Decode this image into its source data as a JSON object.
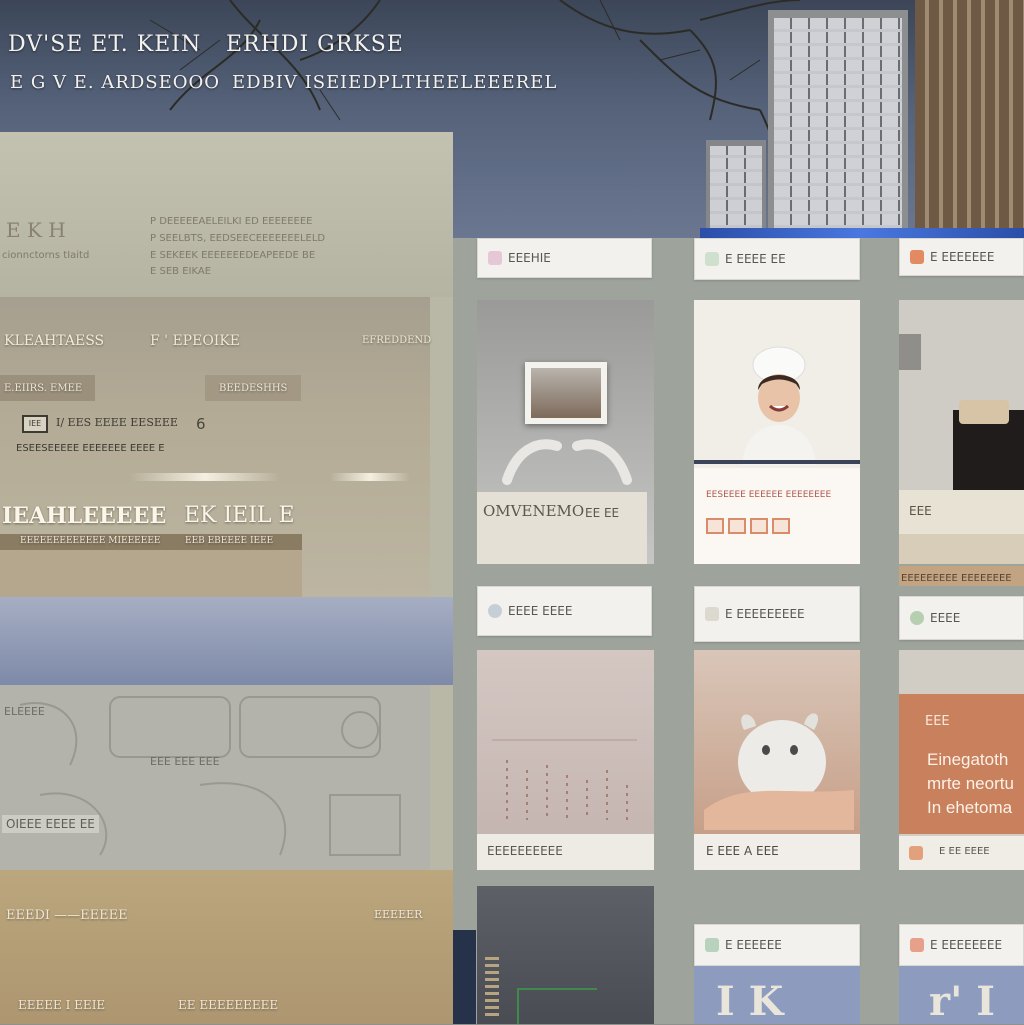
{
  "header": {
    "line1_left": "DV'SE ET.  KEIN",
    "line1_right": "ERHDI GRKSE",
    "line2_a": "E  G   V   E. ARDSEOOO",
    "line2_b": "EDBIV  ISE",
    "line2_c": "IEDPLTHEELEEEREL"
  },
  "left_panel": {
    "intro_title": "E  K H",
    "intro_sub": "cionnctorns tIaitd",
    "intro_desc": [
      "P DEEEEEAELEILKI ED EEEEEEEE",
      "P SEELBTS, EEDSEECEEEEEEELELD",
      "E SEKEEK EEEEEEEDEAPEEDE BE",
      "E SEB EIKAE"
    ],
    "row_a_left": "KLEAHTAESS",
    "row_a_mid": "F ' EPEOIKE",
    "row_a_right": "EFREDDEND",
    "tab_left": "E.EIIRS.  EMEE",
    "tab_right": "BEEDESHHS",
    "small_a": "IEE",
    "small_b": "I/ EES EEEE  EESEEE",
    "small_num": "6",
    "small_line": "ESEESEEEEE EEEEEEE EEEE E",
    "big_left": "IEAHLEEEEE",
    "big_right": "EK IEIL E",
    "cap_left": "EEEEEEEEEEEEE MIEEEEEE",
    "cap_right": "EEB EBEEEE IEEE",
    "lower_items": [
      "ELEEEE",
      "EEE EEE EEE",
      "OIEEE EEEE EE"
    ],
    "footer_left": "EEEDI ——EEEEE",
    "footer_right": "EEEEER",
    "footer_bottom_left": "EEEEE I  EEIE",
    "footer_bottom_right": "EE EEEEEEEEE"
  },
  "cards": {
    "c1_head": "EEEHIE",
    "c2_head": "E EEEE EE",
    "c3_head": "E EEEEEEE",
    "c1_caption": "OMVENEMO",
    "c1_caption2": "EE EE",
    "c2_caption": "EESEEEE EEEEEE EEEEEEEE",
    "c3_caption": "EEE",
    "c3_strip": "EEEEEEEEE EEEEEEEE",
    "c3_head2": "EEEE",
    "c4_head": "EEEE EEEE",
    "c5_head": "E EEEEEEEEE",
    "c6_caption": "EEE EEE EEE",
    "c4_caption": "EEEEEEEEEE",
    "c5_caption": "E EEE A EEE",
    "c6_small": "EEE",
    "c6_big": [
      "Einegatoth",
      "mrte neortu",
      "In ehetoma"
    ],
    "c6_foot": "E  EE  EEEE",
    "c7_head": "E EEEEEE",
    "c8_head": "E EEEEEEEE",
    "c7_big": "I K",
    "c8_big": "r' I"
  },
  "colors": {
    "sky": "#55627a",
    "accent_blue": "#3d6ad8",
    "terracotta": "#c9805c",
    "tan": "#b19b72"
  }
}
